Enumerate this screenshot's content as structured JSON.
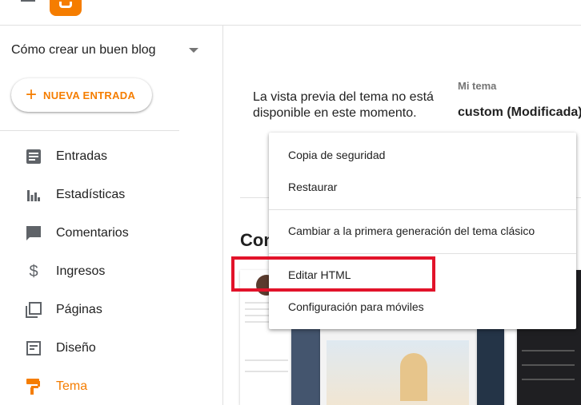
{
  "header": {
    "logo_name": "blogger-logo",
    "brand_color": "#f57d00"
  },
  "sidebar": {
    "blog_name": "Cómo crear un buen blog",
    "new_post_label": "NUEVA ENTRADA",
    "items": [
      {
        "label": "Entradas",
        "icon": "posts-icon",
        "active": false
      },
      {
        "label": "Estadísticas",
        "icon": "stats-icon",
        "active": false
      },
      {
        "label": "Comentarios",
        "icon": "comment-icon",
        "active": false
      },
      {
        "label": "Ingresos",
        "icon": "dollar-icon",
        "active": false
      },
      {
        "label": "Páginas",
        "icon": "pages-icon",
        "active": false
      },
      {
        "label": "Diseño",
        "icon": "layout-icon",
        "active": false
      },
      {
        "label": "Tema",
        "icon": "paint-roller-icon",
        "active": true
      }
    ]
  },
  "main": {
    "preview_message": "La vista previa del tema no está disponible en este momento.",
    "my_theme_label": "Mi tema",
    "my_theme_name": "custom (Modificada)",
    "section_title": "Con"
  },
  "menu": {
    "items": [
      "Copia de seguridad",
      "Restaurar",
      "Cambiar a la primera generación del tema clásico",
      "Editar HTML",
      "Configuración para móviles"
    ],
    "highlighted_item": "Editar HTML",
    "highlight_color": "#e2132a"
  }
}
